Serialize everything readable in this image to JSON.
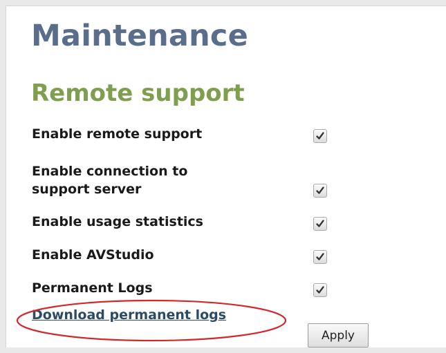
{
  "page": {
    "title": "Maintenance"
  },
  "remote_support": {
    "title": "Remote support",
    "settings": [
      {
        "label_lines": [
          "Enable remote support"
        ],
        "checked": true
      },
      {
        "label_lines": [
          "Enable connection to",
          "support server"
        ],
        "checked": true
      },
      {
        "label_lines": [
          "Enable usage statistics"
        ],
        "checked": true
      },
      {
        "label_lines": [
          "Enable AVStudio"
        ],
        "checked": true
      },
      {
        "label_lines": [
          "Permanent Logs"
        ],
        "checked": true
      }
    ],
    "download_link": "Download permanent logs",
    "apply_label": "Apply"
  },
  "colors": {
    "page_title": "#5a6e8c",
    "section_title": "#7f9e4e",
    "link": "#2a4a66",
    "annotation": "#d4262b",
    "checkmark": "#333333"
  },
  "icons": {
    "checkbox_checked": "checkmark-icon"
  }
}
